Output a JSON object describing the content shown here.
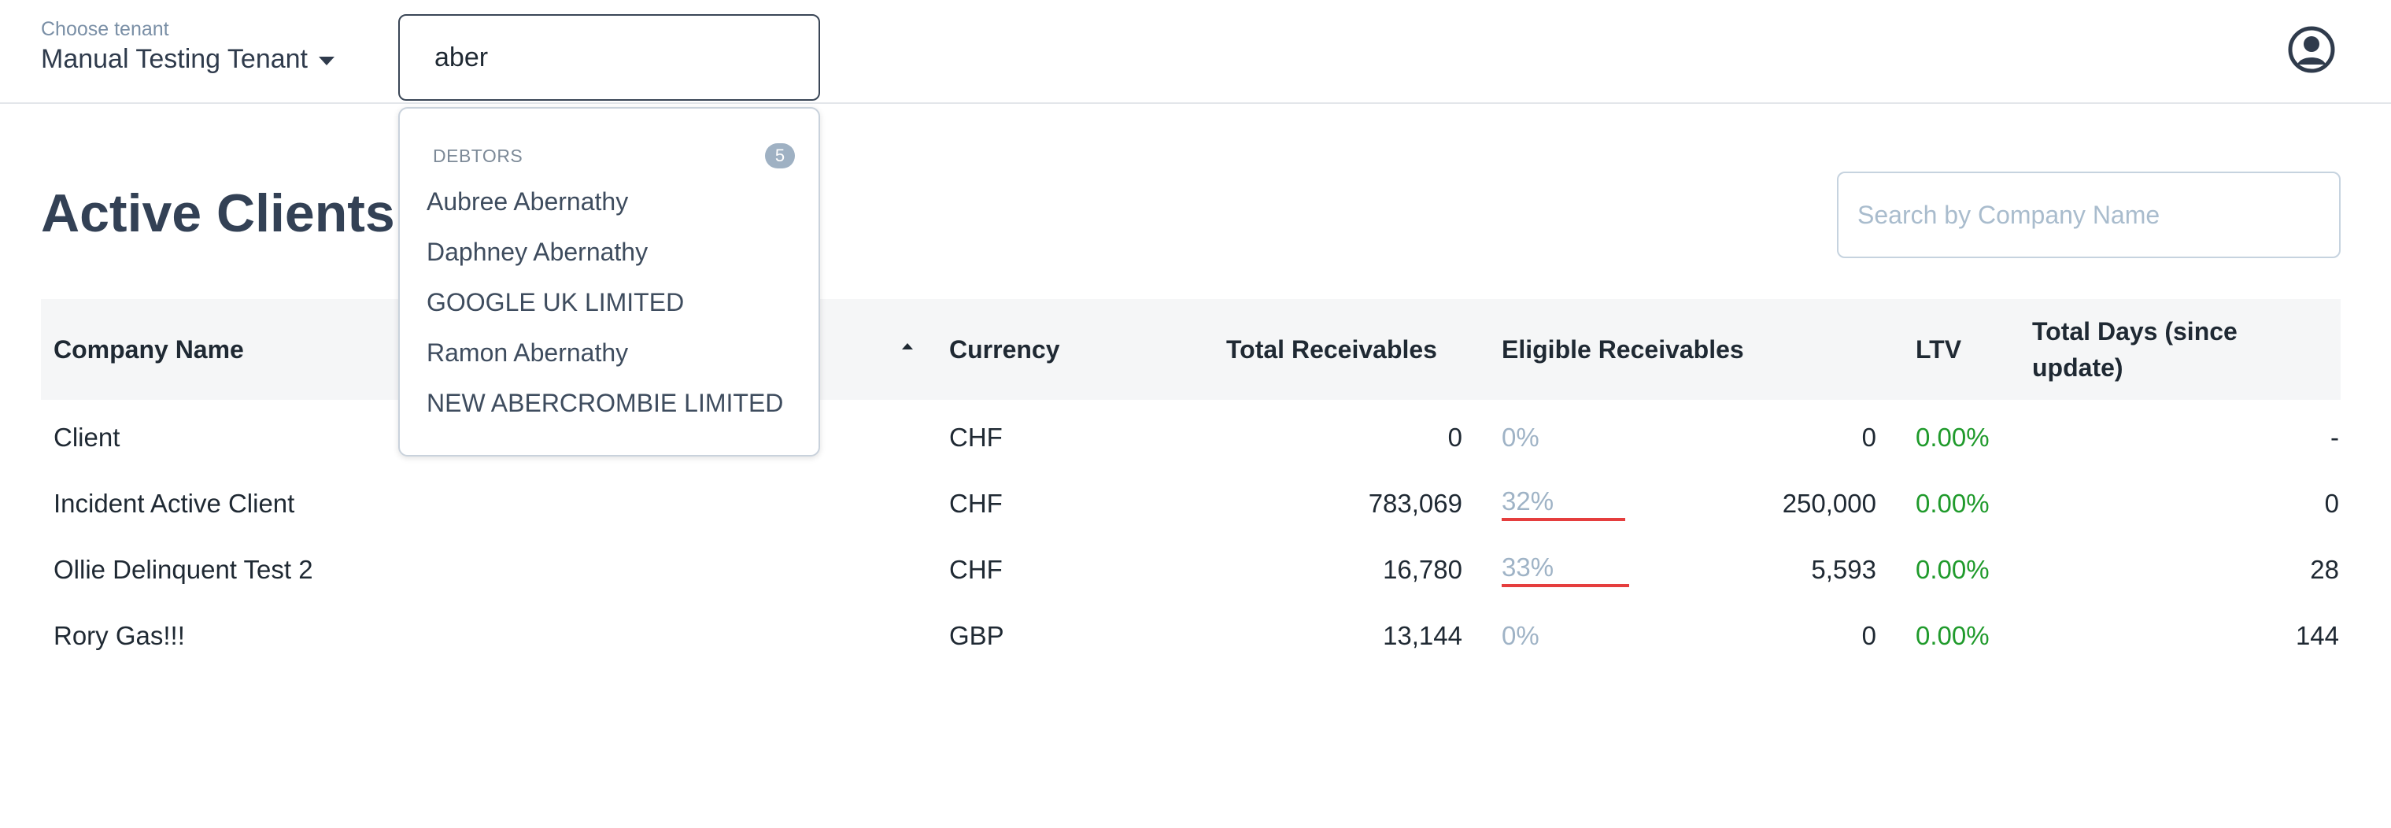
{
  "header": {
    "tenant_label": "Choose tenant",
    "tenant_value": "Manual Testing Tenant",
    "search_value": "aber"
  },
  "dropdown": {
    "section_title": "DEBTORS",
    "count": "5",
    "items": [
      "Aubree Abernathy",
      "Daphney Abernathy",
      "GOOGLE UK LIMITED",
      "Ramon Abernathy",
      "NEW ABERCROMBIE LIMITED"
    ]
  },
  "page": {
    "title": "Active Clients",
    "search_placeholder": "Search by Company Name"
  },
  "table": {
    "columns": {
      "company": "Company Name",
      "currency": "Currency",
      "total_receivables": "Total Receivables",
      "eligible_receivables": "Eligible Receivables",
      "ltv": "LTV",
      "total_days": "Total Days (since update)"
    },
    "sort": {
      "column": "company",
      "direction": "ascending"
    },
    "rows": [
      {
        "company": "Client",
        "currency": "CHF",
        "total": "0",
        "eligible_pct": "0%",
        "eligible_fraction": 0,
        "eligible": "0",
        "ltv": "0.00%",
        "days": "-"
      },
      {
        "company": "Incident Active Client",
        "currency": "CHF",
        "total": "783,069",
        "eligible_pct": "32%",
        "eligible_fraction": 0.32,
        "eligible": "250,000",
        "ltv": "0.00%",
        "days": "0"
      },
      {
        "company": "Ollie Delinquent Test 2",
        "currency": "CHF",
        "total": "16,780",
        "eligible_pct": "33%",
        "eligible_fraction": 0.33,
        "eligible": "5,593",
        "ltv": "0.00%",
        "days": "28"
      },
      {
        "company": "Rory Gas!!!",
        "currency": "GBP",
        "total": "13,144",
        "eligible_pct": "0%",
        "eligible_fraction": 0,
        "eligible": "0",
        "ltv": "0.00%",
        "days": "144"
      }
    ]
  },
  "colors": {
    "ltv": "#1f9a2b",
    "eligible_bar": "#e53e3e",
    "muted_pct": "#9fb3c6"
  },
  "icons": {
    "avatar": "user-circle-icon",
    "tenant_dropdown": "caret-down-icon",
    "sort": "sort-ascending-icon"
  }
}
